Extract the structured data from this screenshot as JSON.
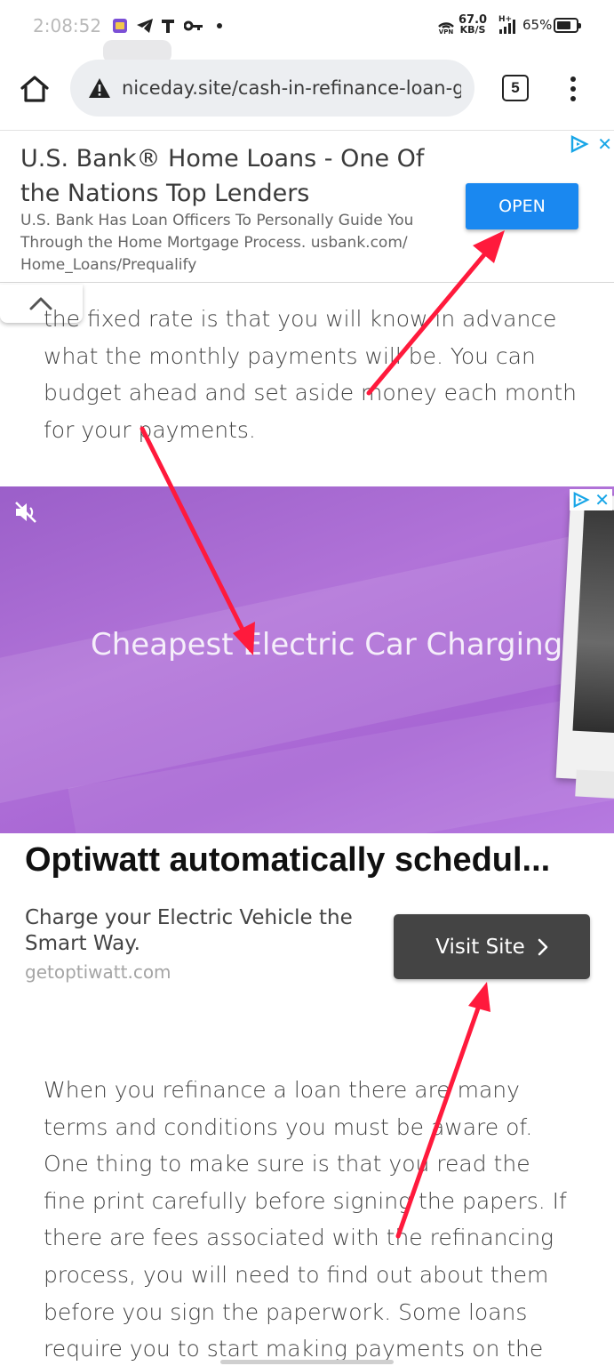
{
  "status_bar": {
    "time": "2:08:52",
    "net_speed": "67.0",
    "net_unit": "KB/S",
    "vpn_label": "VPN",
    "signal_label": "H+",
    "battery": "65%",
    "notification_icons": [
      "app-icon",
      "telegram-icon",
      "t-icon",
      "key-icon",
      "dot-icon"
    ]
  },
  "browser": {
    "url": "niceday.site/cash-in-refinance-loan-ge",
    "tab_count": "5"
  },
  "top_ad": {
    "title": "U.S. Bank® Home Loans - One Of the Nations Top Lenders",
    "description": "U.S. Bank Has Loan Officers To Personally Guide You Through the Home Mortgage Process. usbank.com/ Home_Loans/Prequalify",
    "button": "OPEN"
  },
  "article": {
    "paragraph_1": "the fixed rate is that you will know in advance what the monthly payments will be. You can budget ahead and set aside money each month for your payments.",
    "paragraph_2": "When you refinance a loan there are many terms and conditions you must be aware of. One thing to make sure is that you read the fine print carefully before signing the papers. If there are fees associated with the refinancing process, you will need to find out about them before you sign the paperwork. Some loans require you to start making payments on the day you close the deal while other"
  },
  "video_ad": {
    "caption": "Cheapest Electric Car Charging",
    "title": "Optiwatt automatically schedul...",
    "description": "Charge your Electric Vehicle the Smart Way.",
    "domain": "getoptiwatt.com",
    "button": "Visit Site"
  },
  "colors": {
    "open_button": "#1a88f0",
    "visit_button": "#444444",
    "video_background": "#a866d4",
    "annotation_arrow": "#ff1a3c",
    "adchoices": "#19a6e7"
  }
}
